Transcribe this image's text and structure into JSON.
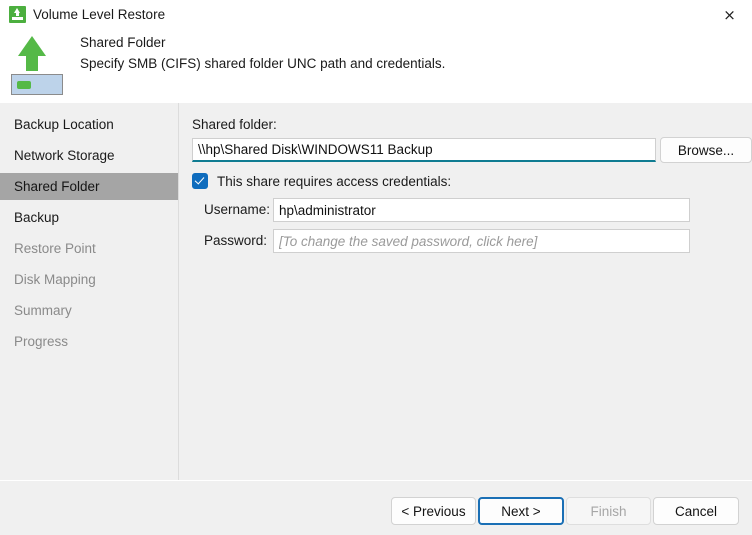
{
  "window": {
    "title": "Volume Level Restore",
    "icon": "volume-restore-icon",
    "close_label": "×"
  },
  "header": {
    "icon": "green-up-arrow-drive-icon",
    "title": "Shared Folder",
    "subtitle": "Specify SMB (CIFS) shared folder UNC path and credentials."
  },
  "sidebar": {
    "items": [
      {
        "label": "Backup Location",
        "state": "enabled"
      },
      {
        "label": "Network Storage",
        "state": "enabled"
      },
      {
        "label": "Shared Folder",
        "state": "selected"
      },
      {
        "label": "Backup",
        "state": "enabled"
      },
      {
        "label": "Restore Point",
        "state": "disabled"
      },
      {
        "label": "Disk Mapping",
        "state": "disabled"
      },
      {
        "label": "Summary",
        "state": "disabled"
      },
      {
        "label": "Progress",
        "state": "disabled"
      }
    ]
  },
  "form": {
    "shared_folder_label": "Shared folder:",
    "shared_folder_value": "\\\\hp\\Shared Disk\\WINDOWS11 Backup",
    "shared_folder_placeholder": "",
    "browse_label": "Browse...",
    "credentials_checkbox_label": "This share requires access credentials:",
    "credentials_checked": true,
    "username_label": "Username:",
    "username_value": "hp\\administrator",
    "username_placeholder": "",
    "password_label": "Password:",
    "password_value": "",
    "password_placeholder": "[To change the saved password, click here]"
  },
  "footer": {
    "previous_label": "< Previous",
    "next_label": "Next >",
    "finish_label": "Finish",
    "cancel_label": "Cancel"
  },
  "colors": {
    "accent_focus_underline": "#0f7c92",
    "checkbox_blue": "#0f6cbd",
    "default_button_border": "#1a6fb5",
    "icon_green": "#55b947",
    "selected_nav_bg": "#a5a5a5"
  }
}
